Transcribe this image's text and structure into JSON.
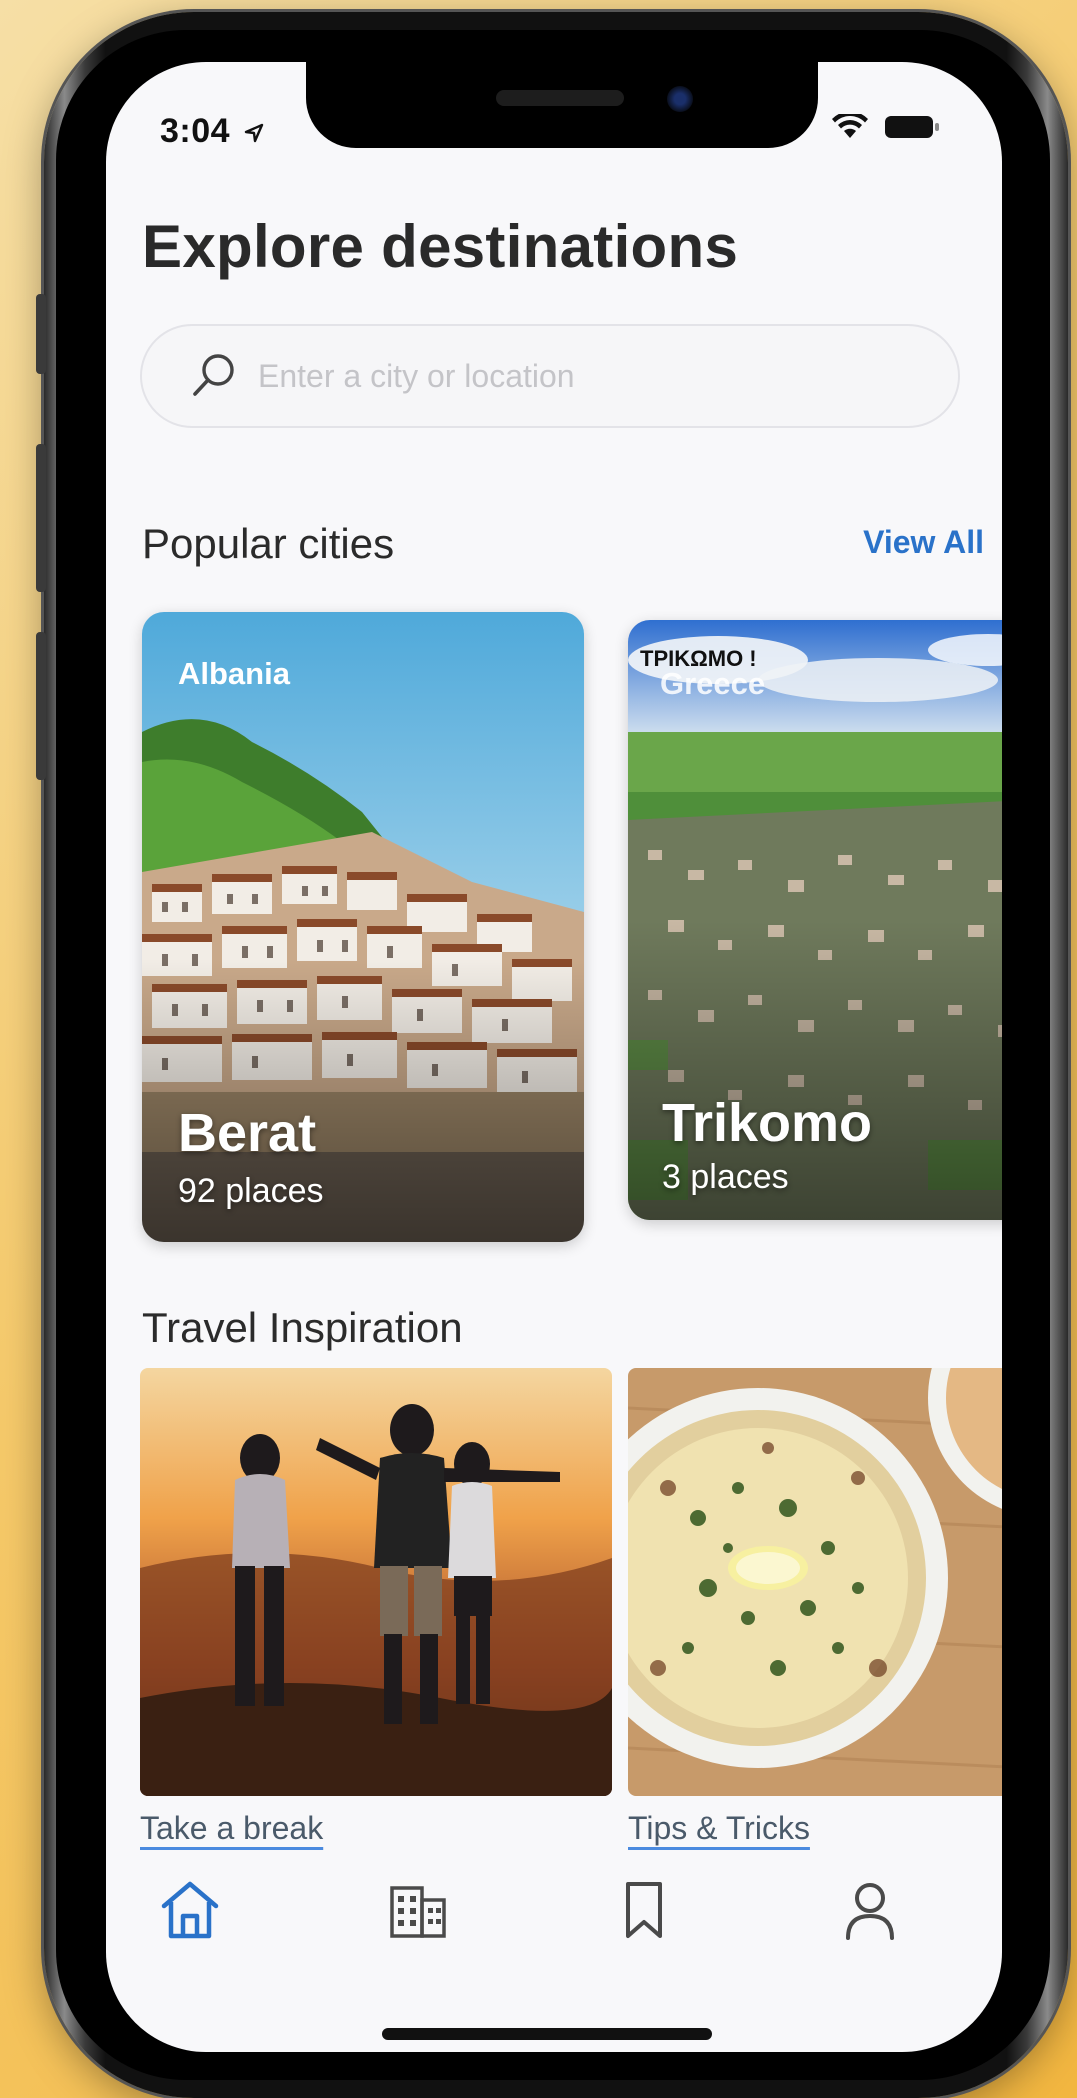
{
  "status_bar": {
    "time": "3:04"
  },
  "header": {
    "title": "Explore destinations"
  },
  "search": {
    "placeholder": "Enter a city or location",
    "value": ""
  },
  "popular": {
    "title": "Popular cities",
    "view_all": "View All",
    "cities": [
      {
        "country": "Albania",
        "name": "Berat",
        "places": "92 places"
      },
      {
        "country": "Greece",
        "name": "Trikomo",
        "places": "3 places",
        "sign": "ΤΡΙΚΩΜΟ !"
      }
    ]
  },
  "inspiration": {
    "title": "Travel Inspiration",
    "items": [
      {
        "label": "Take a break"
      },
      {
        "label": "Tips & Tricks"
      }
    ]
  },
  "tabs": [
    {
      "name": "home",
      "active": true
    },
    {
      "name": "hotels",
      "active": false
    },
    {
      "name": "saved",
      "active": false
    },
    {
      "name": "profile",
      "active": false
    }
  ],
  "colors": {
    "accent": "#2a72c9",
    "inactive": "#4a4a4a",
    "background": "#f8f8fa"
  }
}
